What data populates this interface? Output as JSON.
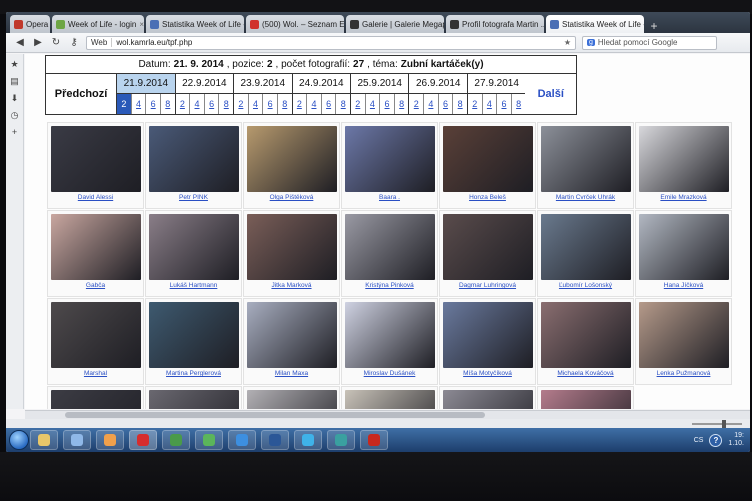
{
  "browser": {
    "tabs": [
      {
        "label": "Opera",
        "color": "#c0392b",
        "active": false
      },
      {
        "label": "Week of Life - login",
        "color": "#6ea645",
        "active": false
      },
      {
        "label": "Statistika Week of Life - ...",
        "color": "#4a6fb5",
        "active": false
      },
      {
        "label": "(500) Wol. – Seznam E...",
        "color": "#d0312d",
        "active": false
      },
      {
        "label": "Galerie | Galerie Megap...",
        "color": "#333333",
        "active": false
      },
      {
        "label": "Profil fotografa Martin ...",
        "color": "#333333",
        "active": false
      },
      {
        "label": "Statistika Week of Life - ...",
        "color": "#4a6fb5",
        "active": true
      }
    ],
    "address_tag": "Web",
    "url": "wol.kamrla.eu/tpf.php",
    "search_placeholder": "Hledat pomocí Google",
    "search_engine_icon": "google-icon"
  },
  "header": {
    "datum_label": "Datum:",
    "datum_value": "21. 9. 2014",
    "pozice_label": ", pozice:",
    "pozice_value": "2",
    "pocet_label": ", počet fotografií:",
    "pocet_value": "27",
    "tema_label": ", téma:",
    "tema_value": "Zubní kartáček(y)",
    "prev_label": "Předchozí",
    "next_label": "Další",
    "days": [
      {
        "date": "21.9.2014",
        "pages": [
          "2",
          "4",
          "6",
          "8"
        ],
        "active": true
      },
      {
        "date": "22.9.2014",
        "pages": [
          "2",
          "4",
          "6",
          "8"
        ],
        "active": false
      },
      {
        "date": "23.9.2014",
        "pages": [
          "2",
          "4",
          "6",
          "8"
        ],
        "active": false
      },
      {
        "date": "24.9.2014",
        "pages": [
          "2",
          "4",
          "6",
          "8"
        ],
        "active": false
      },
      {
        "date": "25.9.2014",
        "pages": [
          "2",
          "4",
          "6",
          "8"
        ],
        "active": false
      },
      {
        "date": "26.9.2014",
        "pages": [
          "2",
          "4",
          "6",
          "8"
        ],
        "active": false
      },
      {
        "date": "27.9.2014",
        "pages": [
          "2",
          "4",
          "6",
          "8"
        ],
        "active": false
      }
    ]
  },
  "photos": [
    {
      "author": "David Alessi",
      "tone": "#3a3b45"
    },
    {
      "author": "Petr PINK",
      "tone": "#4a5a78"
    },
    {
      "author": "Olga Pištěková",
      "tone": "#b79a6e"
    },
    {
      "author": "Baara .",
      "tone": "#6c78a8"
    },
    {
      "author": "Honza Beleš",
      "tone": "#5a4038"
    },
    {
      "author": "Martin Cvrček Uhrák",
      "tone": "#8c9099"
    },
    {
      "author": "Emile Mrazková",
      "tone": "#d8d8dc"
    },
    {
      "author": "Gabča",
      "tone": "#c9a7a0"
    },
    {
      "author": "Lukáš Hartmann",
      "tone": "#8a7e88"
    },
    {
      "author": "Jitka Marková",
      "tone": "#7a5e58"
    },
    {
      "author": "Kristýna Pinková",
      "tone": "#9a9aa4"
    },
    {
      "author": "Dagmar Luhringová",
      "tone": "#5a4c4c"
    },
    {
      "author": "Ľubomír Lošonský",
      "tone": "#6a7a8e"
    },
    {
      "author": "Hana Jíčková",
      "tone": "#b2b8c2"
    },
    {
      "author": "Marshal",
      "tone": "#4e4a4c"
    },
    {
      "author": "Martina Perglerová",
      "tone": "#3e5a70"
    },
    {
      "author": "Milan Maxa",
      "tone": "#a8aec0"
    },
    {
      "author": "Miroslav Dušánek",
      "tone": "#cfd2e2"
    },
    {
      "author": "Míša Motyčíková",
      "tone": "#6a7a9e"
    },
    {
      "author": "Michaela Kováčová",
      "tone": "#8a6e70"
    },
    {
      "author": "Lenka Pužmanová",
      "tone": "#b59a8a"
    },
    {
      "author": "",
      "tone": "#3c3c44"
    },
    {
      "author": "",
      "tone": "#6a6870"
    },
    {
      "author": "",
      "tone": "#b2b0b4"
    },
    {
      "author": "",
      "tone": "#c8c2b8"
    },
    {
      "author": "",
      "tone": "#8c8a94"
    },
    {
      "author": "",
      "tone": "#b47c8c"
    }
  ],
  "taskbar": {
    "apps": [
      {
        "name": "explorer-icon",
        "color": "#e8c76a"
      },
      {
        "name": "network-icon",
        "color": "#8fb8e8"
      },
      {
        "name": "media-player-icon",
        "color": "#f0a04b"
      },
      {
        "name": "opera-icon",
        "color": "#d62d2d"
      },
      {
        "name": "chrome-icon",
        "color": "#4a9a4a"
      },
      {
        "name": "chart-app-icon",
        "color": "#5bb55b"
      },
      {
        "name": "ie-icon",
        "color": "#3d8fe0"
      },
      {
        "name": "word-icon",
        "color": "#2b5797"
      },
      {
        "name": "skype-icon",
        "color": "#3fb2e8"
      },
      {
        "name": "app-icon",
        "color": "#3aa0a0"
      },
      {
        "name": "pdf-icon",
        "color": "#c8281e"
      }
    ],
    "lang": "CS",
    "time": "19:",
    "date": "1.10."
  }
}
